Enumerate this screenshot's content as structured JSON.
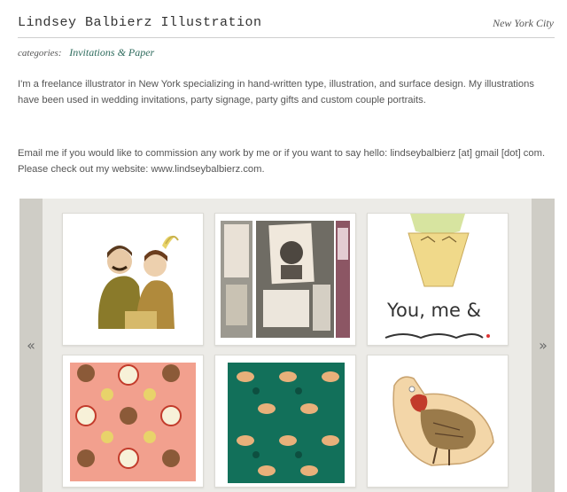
{
  "header": {
    "title": "Lindsey Balbierz Illustration",
    "location": "New York City"
  },
  "categories": {
    "label": "categories:",
    "items": [
      "Invitations & Paper"
    ]
  },
  "bio": "I'm a freelance illustrator in New York specializing in hand-written type, illustration, and surface design. My illustrations have been used in wedding invitations, party signage, party gifts and custom couple portraits.",
  "contact": "Email me if you would like to commission any work by me or if you want to say hello: lindseybalbierz [at] gmail [dot] com. Please check out my website: www.lindseybalbierz.com.",
  "gallery": {
    "prev_label": "«",
    "next_label": "»",
    "cone_text": "You, me &",
    "items": [
      "couple-portrait",
      "invitation-photos",
      "ice-cream-cone",
      "animal-pattern-pink",
      "fox-pattern-green",
      "bird-ornament"
    ]
  }
}
